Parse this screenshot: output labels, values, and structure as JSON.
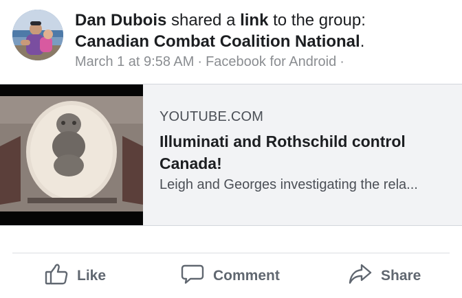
{
  "post": {
    "author": "Dan Dubois",
    "action_text_1": " shared a ",
    "link_word": "link",
    "action_text_2": " to the group:",
    "group_name": "Canadian Combat Coalition National",
    "group_suffix": ".",
    "timestamp": "March 1 at 9:58 AM",
    "separator": "·",
    "source": "Facebook for Android",
    "separator_end": "·"
  },
  "link_card": {
    "domain": "YOUTUBE.COM",
    "title": "Illuminati and Rothschild control Canada!",
    "description": "Leigh and Georges investigating the rela..."
  },
  "actions": {
    "like_label": "Like",
    "comment_label": "Comment",
    "share_label": "Share"
  },
  "icons": {
    "like": "thumbs-up-icon",
    "comment": "speech-bubble-icon",
    "share": "share-arrow-icon"
  },
  "colors": {
    "primary_text": "#1c1e21",
    "secondary_text": "#8a8d91",
    "action_text": "#606770",
    "card_background": "#f2f3f5"
  }
}
